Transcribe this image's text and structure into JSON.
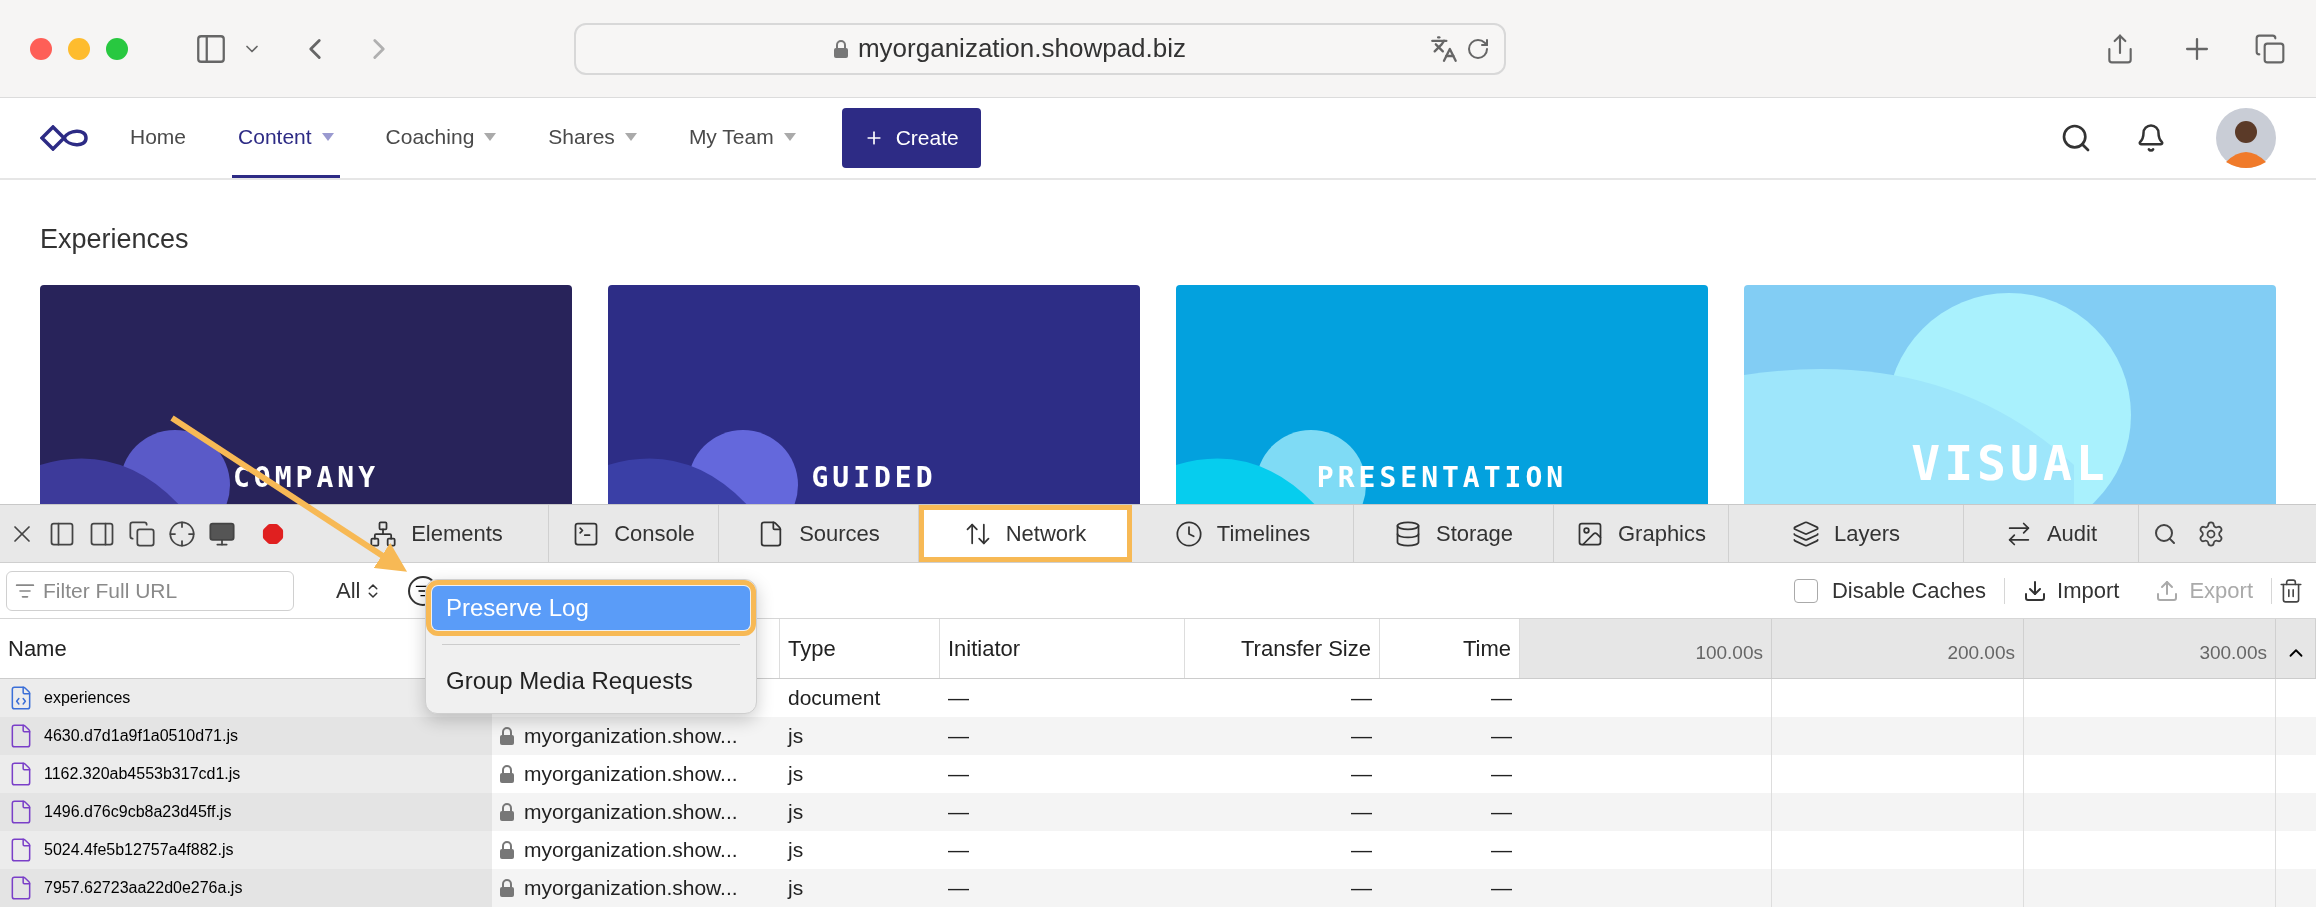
{
  "browser": {
    "url": "myorganization.showpad.biz"
  },
  "nav": {
    "items": [
      {
        "label": "Home",
        "selected": false,
        "dropdown": false
      },
      {
        "label": "Content",
        "selected": true,
        "dropdown": true
      },
      {
        "label": "Coaching",
        "selected": false,
        "dropdown": true
      },
      {
        "label": "Shares",
        "selected": false,
        "dropdown": true
      },
      {
        "label": "My Team",
        "selected": false,
        "dropdown": true
      }
    ],
    "create_button": {
      "label": "Create"
    }
  },
  "page_title": "Experiences",
  "cards": [
    {
      "title": "COMPANY",
      "color": "#28235a"
    },
    {
      "title": "GUIDED",
      "color": "#2d2d86"
    },
    {
      "title": "PRESENTATION",
      "color": "#03a1de"
    },
    {
      "title": "VISUAL",
      "color": "#82cdf4"
    }
  ],
  "devtools": {
    "tabs": [
      {
        "label": "Elements",
        "selected": false,
        "highlighted": false
      },
      {
        "label": "Console",
        "selected": false,
        "highlighted": false
      },
      {
        "label": "Sources",
        "selected": false,
        "highlighted": false
      },
      {
        "label": "Network",
        "selected": true,
        "highlighted": true
      },
      {
        "label": "Timelines",
        "selected": false,
        "highlighted": false
      },
      {
        "label": "Storage",
        "selected": false,
        "highlighted": false
      },
      {
        "label": "Graphics",
        "selected": false,
        "highlighted": false
      },
      {
        "label": "Layers",
        "selected": false,
        "highlighted": false
      },
      {
        "label": "Audit",
        "selected": false,
        "highlighted": false
      }
    ],
    "filter": {
      "placeholder": "Filter Full URL"
    },
    "type_filter": "All",
    "disable_caches": {
      "label": "Disable Caches",
      "checked": false
    },
    "import": {
      "label": "Import",
      "disabled": false
    },
    "export": {
      "label": "Export",
      "disabled": true
    },
    "popup": [
      {
        "label": "Preserve Log",
        "selected": true,
        "highlighted": true
      },
      {
        "label": "Group Media Requests",
        "selected": false,
        "highlighted": false
      }
    ],
    "columns": [
      "Name",
      "Type",
      "Initiator",
      "Transfer Size",
      "Time"
    ],
    "timeline_ticks": [
      "100.00s",
      "200.00s",
      "300.00s"
    ],
    "rows": [
      {
        "name": "experiences",
        "kind": "document",
        "type": "document",
        "initiator": "—",
        "transfer_size": "—",
        "time": "—"
      },
      {
        "name": "4630.d7d1a9f1a0510d71.js",
        "kind": "script",
        "domain": "myorganization.show...",
        "type": "js",
        "initiator": "—",
        "transfer_size": "—",
        "time": "—"
      },
      {
        "name": "1162.320ab4553b317cd1.js",
        "kind": "script",
        "domain": "myorganization.show...",
        "type": "js",
        "initiator": "—",
        "transfer_size": "—",
        "time": "—"
      },
      {
        "name": "1496.d76c9cb8a23d45ff.js",
        "kind": "script",
        "domain": "myorganization.show...",
        "type": "js",
        "initiator": "—",
        "transfer_size": "—",
        "time": "—"
      },
      {
        "name": "5024.4fe5b12757a4f882.js",
        "kind": "script",
        "domain": "myorganization.show...",
        "type": "js",
        "initiator": "—",
        "transfer_size": "—",
        "time": "—"
      },
      {
        "name": "7957.62723aa22d0e276a.js",
        "kind": "script",
        "domain": "myorganization.show...",
        "type": "js",
        "initiator": "—",
        "transfer_size": "—",
        "time": "—"
      }
    ]
  }
}
